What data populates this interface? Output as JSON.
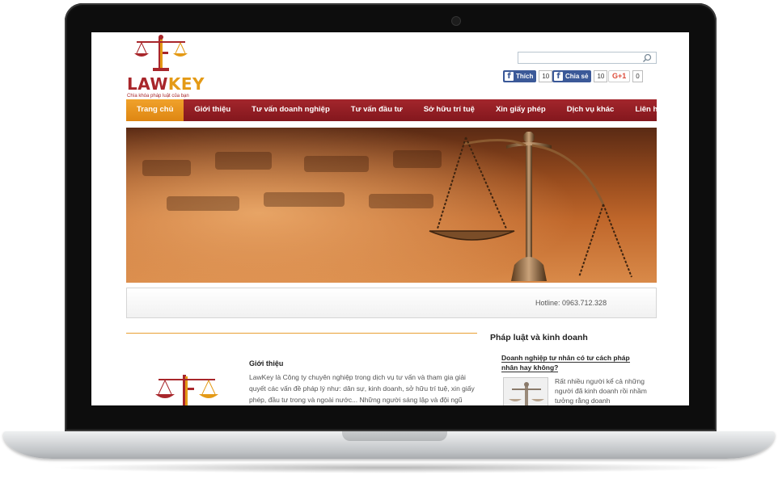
{
  "site": {
    "logo_text_law": "LAW",
    "logo_text_key": "KEY",
    "slogan": "Chìa khóa pháp luật của bạn"
  },
  "search": {
    "placeholder": "",
    "icon": "search-icon"
  },
  "social": {
    "facebook_like": {
      "label": "Thích",
      "count": "10"
    },
    "facebook_share": {
      "label": "Chia sẻ",
      "count": "10"
    },
    "google_plus": {
      "label": "G+1",
      "count": "0"
    }
  },
  "nav": {
    "items": [
      {
        "label": "Trang chủ",
        "active": true
      },
      {
        "label": "Giới thiệu"
      },
      {
        "label": "Tư vấn doanh nghiệp"
      },
      {
        "label": "Tư vấn đầu tư"
      },
      {
        "label": "Sở hữu trí tuệ"
      },
      {
        "label": "Xin giấy phép"
      },
      {
        "label": "Dịch vụ khác"
      },
      {
        "label": "Liên hệ"
      }
    ]
  },
  "hotline": "Hotline: 0963.712.328",
  "intro": {
    "title": "Giới thiệu",
    "text": "LawKey là Công ty chuyên nghiệp trong dịch vụ tư vấn và tham gia giải quyết các vấn đề pháp lý như: dân sự, kinh doanh, sở hữu trí tuệ, xin giấy phép, đầu tư trong và ngoài nước... Những người sáng lập và đội ngũ chuyên gia của chúng tôi đã từng đảm nhận các công việc quan trọng tại"
  },
  "sidebar": {
    "title": "Pháp luật và kinh doanh",
    "article_link": "Doanh nghiệp tư nhân có tư cách pháp nhân hay không?",
    "article_excerpt": "Rất nhiều người kể cả những người đã kinh doanh rồi nhầm tưởng rằng doanh"
  },
  "colors": {
    "brand_red": "#a3262c",
    "brand_orange": "#e49a16",
    "facebook_blue": "#3b5998"
  }
}
